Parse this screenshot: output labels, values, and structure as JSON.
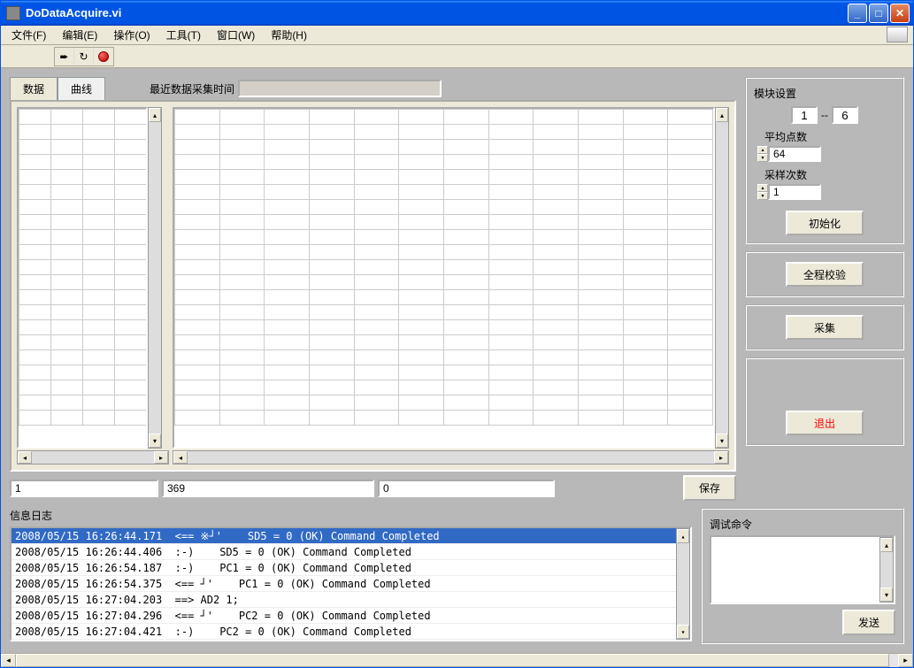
{
  "window": {
    "title": "DoDataAcquire.vi"
  },
  "menu": {
    "file": "文件(F)",
    "edit": "编辑(E)",
    "operate": "操作(O)",
    "tools": "工具(T)",
    "window": "窗口(W)",
    "help": "帮助(H)"
  },
  "tabs": {
    "data": "数据",
    "curve": "曲线"
  },
  "labels": {
    "recent_acquire_time": "最近数据采集时间",
    "info_log": "信息日志",
    "debug_cmd": "调试命令",
    "module_settings": "模块设置",
    "avg_points": "平均点数",
    "sample_count": "采样次数",
    "separator": "--"
  },
  "inputs": {
    "module_start": "1",
    "module_end": "6",
    "avg_points": "64",
    "sample_count": "1",
    "bottom_v1": "1",
    "bottom_v2": "369",
    "bottom_v3": "0"
  },
  "buttons": {
    "save": "保存",
    "init": "初始化",
    "calibrate": "全程校验",
    "acquire": "采集",
    "exit": "退出",
    "send": "发送"
  },
  "log": [
    {
      "text": "2008/05/15 16:26:44.171  <== ※┘'    SD5 = 0 (OK) Command Completed",
      "selected": true
    },
    {
      "text": "2008/05/15 16:26:44.406  :-)    SD5 = 0 (OK) Command Completed",
      "selected": false
    },
    {
      "text": "2008/05/15 16:26:54.187  :-)    PC1 = 0 (OK) Command Completed",
      "selected": false
    },
    {
      "text": "2008/05/15 16:26:54.375  <== ┘'    PC1 = 0 (OK) Command Completed",
      "selected": false
    },
    {
      "text": "2008/05/15 16:27:04.203  ==> AD2 1;",
      "selected": false
    },
    {
      "text": "2008/05/15 16:27:04.296  <== ┘'    PC2 = 0 (OK) Command Completed",
      "selected": false
    },
    {
      "text": "2008/05/15 16:27:04.421  :-)    PC2 = 0 (OK) Command Completed",
      "selected": false
    }
  ]
}
